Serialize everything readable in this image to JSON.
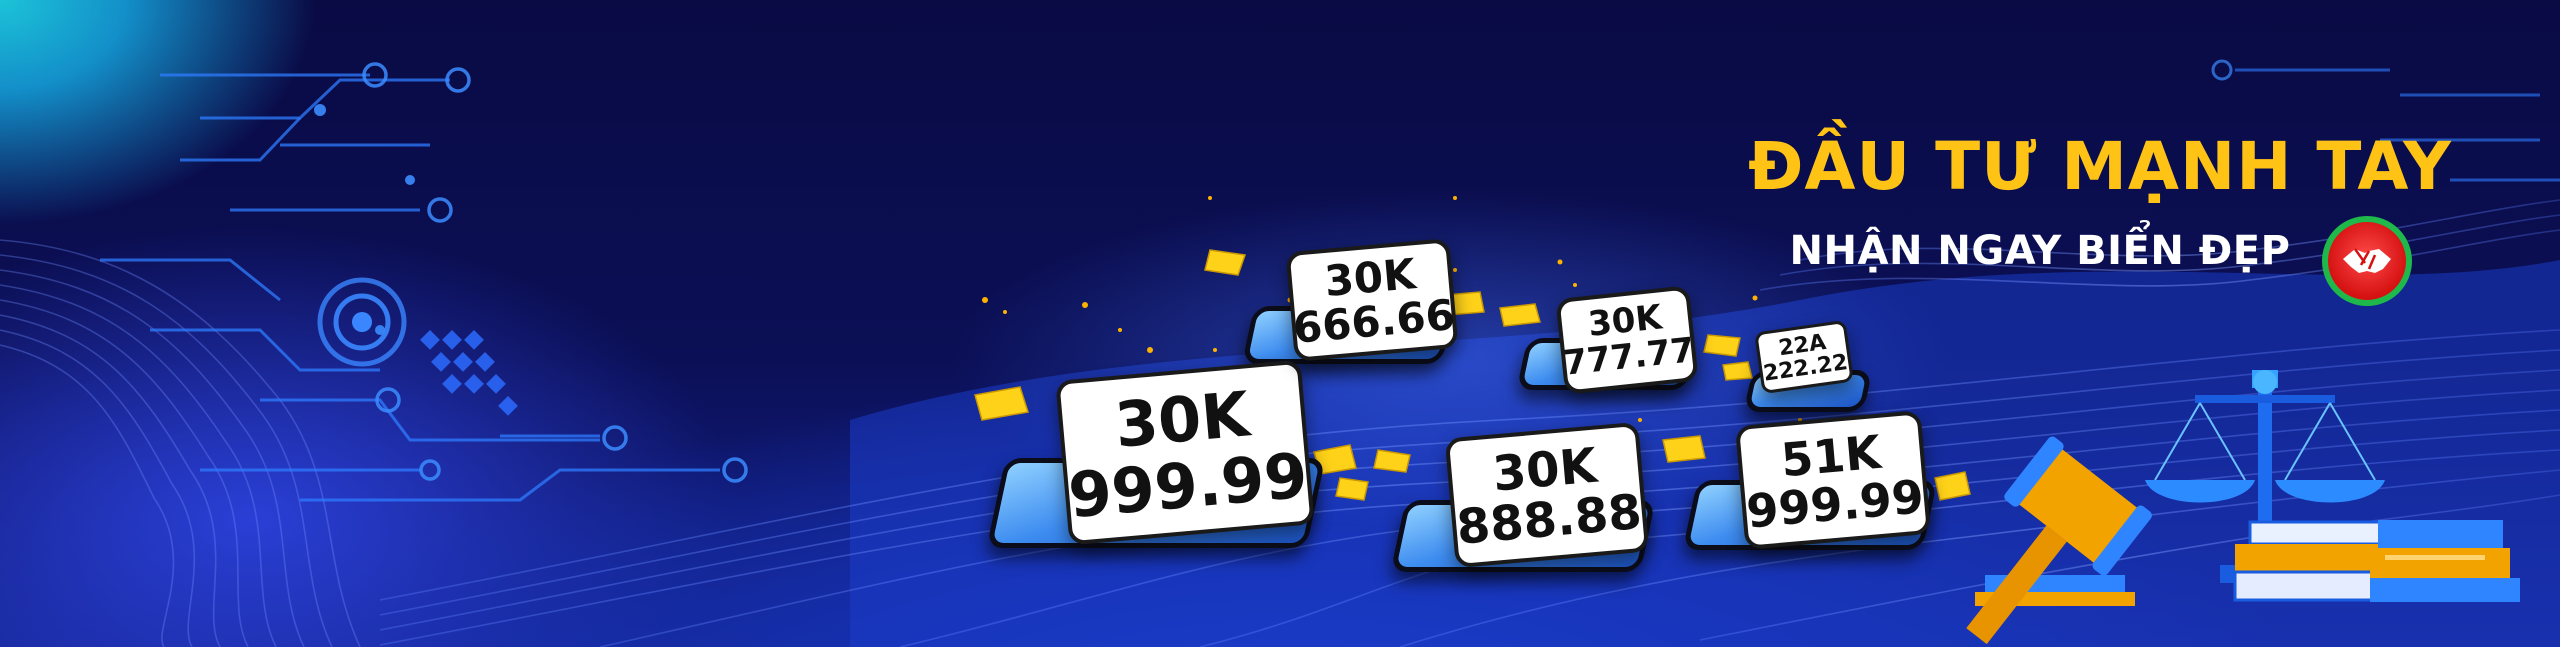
{
  "banner": {
    "headline": "ĐẦU TƯ MẠNH TAY",
    "subline": "NHẬN NGAY BIỂN ĐẸP",
    "colors": {
      "headline": "#ffc316",
      "subline": "#ffffff",
      "background": "#0a0c4a",
      "accent_blue": "#1f44d8",
      "badge_red": "#d51111",
      "badge_ring": "#1fb84a"
    },
    "badge_icon": "handshake-icon",
    "decor_icons": [
      "circuit-lines",
      "target-rings",
      "diamond-grid",
      "scales-of-justice",
      "gavel",
      "books",
      "coins"
    ]
  },
  "plates": [
    {
      "top": "30K",
      "bottom": "999.99"
    },
    {
      "top": "30K",
      "bottom": "666.66"
    },
    {
      "top": "30K",
      "bottom": "777.77"
    },
    {
      "top": "22A",
      "bottom": "222.22"
    },
    {
      "top": "30K",
      "bottom": "888.88"
    },
    {
      "top": "51K",
      "bottom": "999.99"
    }
  ]
}
